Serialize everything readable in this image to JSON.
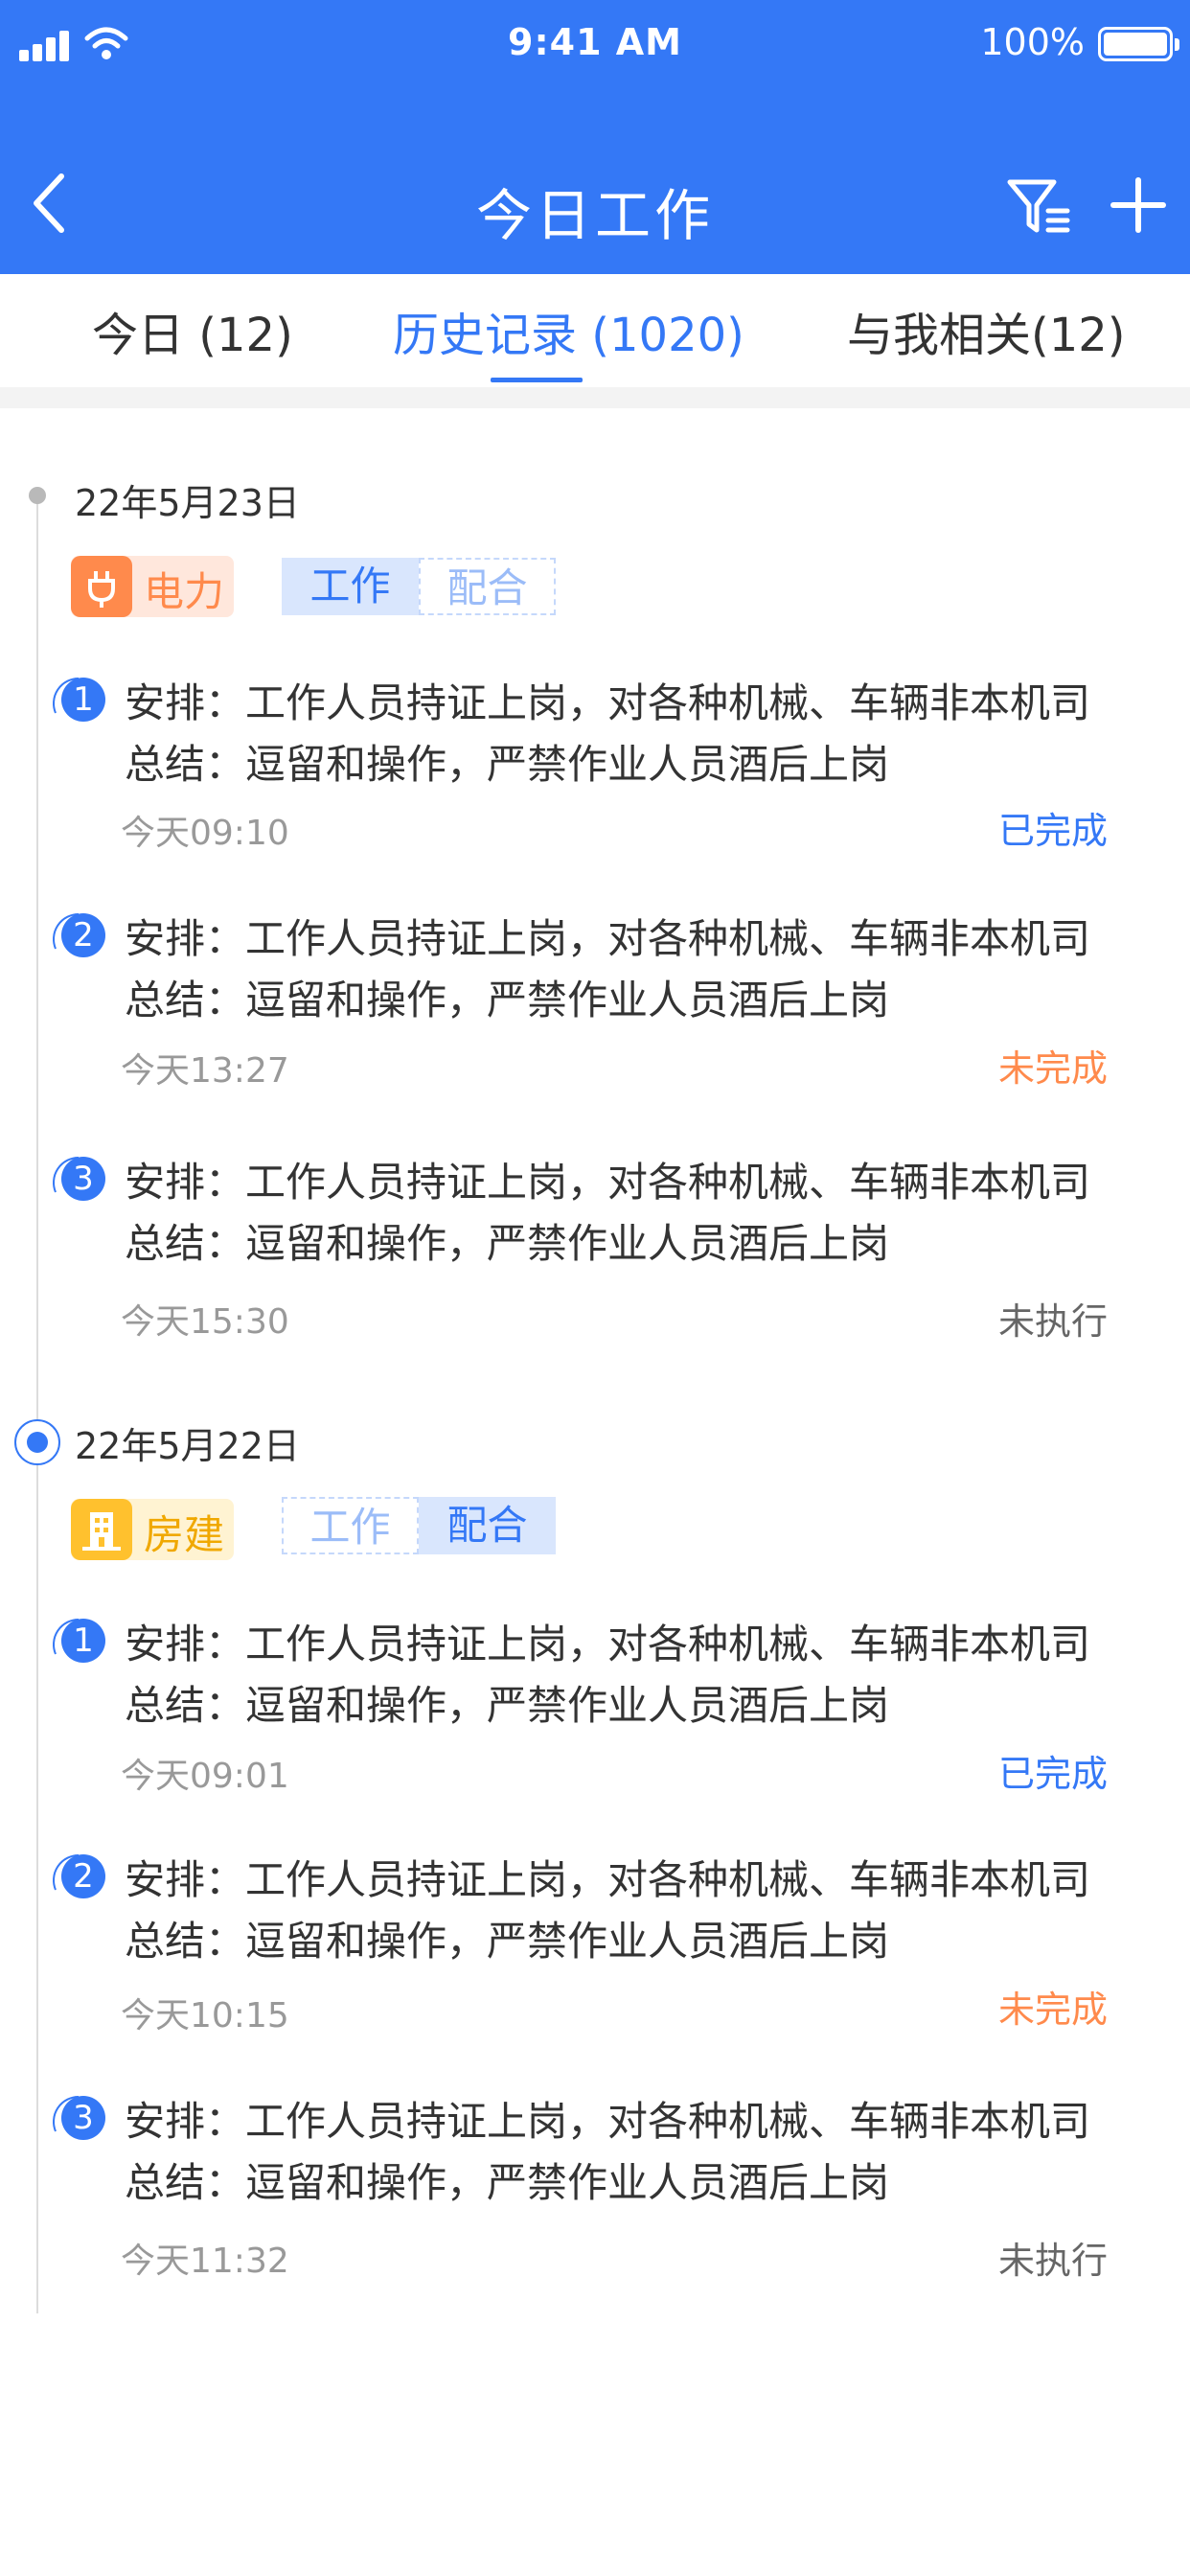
{
  "status_bar": {
    "time": "9:41 AM",
    "battery": "100%"
  },
  "nav": {
    "title": "今日工作"
  },
  "tabs": [
    {
      "label": "今日 (12)"
    },
    {
      "label": "历史记录 (1020)"
    },
    {
      "label": "与我相关(12)"
    }
  ],
  "groups": [
    {
      "date": "22年5月23日",
      "category": "电力",
      "segments": [
        "工作",
        "配合"
      ],
      "items": [
        {
          "num": "1",
          "line1": "安排：工作人员持证上岗，对各种机械、车辆非本机司",
          "line2": "总结：逗留和操作，严禁作业人员酒后上岗",
          "time": "今天09:10",
          "status": "已完成"
        },
        {
          "num": "2",
          "line1": "安排：工作人员持证上岗，对各种机械、车辆非本机司",
          "line2": "总结：逗留和操作，严禁作业人员酒后上岗",
          "time": "今天13:27",
          "status": "未完成"
        },
        {
          "num": "3",
          "line1": "安排：工作人员持证上岗，对各种机械、车辆非本机司",
          "line2": "总结：逗留和操作，严禁作业人员酒后上岗",
          "time": "今天15:30",
          "status": "未执行"
        }
      ]
    },
    {
      "date": "22年5月22日",
      "category": "房建",
      "segments": [
        "工作",
        "配合"
      ],
      "items": [
        {
          "num": "1",
          "line1": "安排：工作人员持证上岗，对各种机械、车辆非本机司",
          "line2": "总结：逗留和操作，严禁作业人员酒后上岗",
          "time": "今天09:01",
          "status": "已完成"
        },
        {
          "num": "2",
          "line1": "安排：工作人员持证上岗，对各种机械、车辆非本机司",
          "line2": "总结：逗留和操作，严禁作业人员酒后上岗",
          "time": "今天10:15",
          "status": "未完成"
        },
        {
          "num": "3",
          "line1": "安排：工作人员持证上岗，对各种机械、车辆非本机司",
          "line2": "总结：逗留和操作，严禁作业人员酒后上岗",
          "time": "今天11:32",
          "status": "未执行"
        }
      ]
    }
  ],
  "colors": {
    "primary": "#3478f6",
    "done": "#3478f6",
    "undone": "#ff8a4c",
    "pending": "#666666",
    "power": "#ff8a4c",
    "building": "#ffc12e"
  }
}
